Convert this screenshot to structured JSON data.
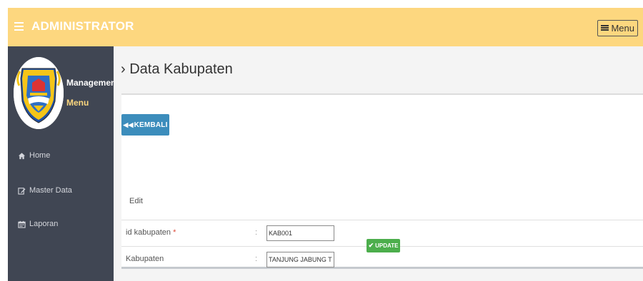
{
  "topbar": {
    "brand": "ADMINISTRATOR",
    "menu_label": "Menu",
    "color": "#fdd77f"
  },
  "sidebar": {
    "logo_alt": "regency-emblem",
    "management_label": "Management",
    "menu_label": "Menu",
    "items": [
      {
        "label": "Home",
        "icon": "home-icon"
      },
      {
        "label": "Master Data",
        "icon": "edit-icon"
      },
      {
        "label": "Laporan",
        "icon": "calendar-icon"
      }
    ],
    "color": "#404653"
  },
  "main": {
    "page_title": "Data Kabupaten",
    "back_label": "KEMBALI",
    "form_title": "Edit",
    "fields": [
      {
        "label": "id kabupaten",
        "required": "*",
        "value": "KAB001"
      },
      {
        "label": "Kabupaten",
        "required": "",
        "value": "TANJUNG JABUNG TIMUR"
      }
    ],
    "update_label": "UPDATE"
  }
}
